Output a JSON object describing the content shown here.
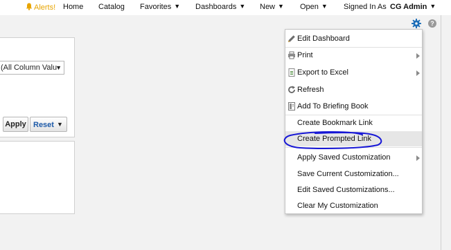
{
  "header": {
    "alerts_label": "Alerts!",
    "alerts_color": "#e8a500",
    "nav": {
      "home": "Home",
      "catalog": "Catalog",
      "favorites": "Favorites",
      "dashboards": "Dashboards",
      "new": "New",
      "open": "Open"
    },
    "signed_in_as": "Signed In As",
    "user_name": "CG Admin",
    "caret": "▼"
  },
  "prompt": {
    "select_value": "(All Column Valu",
    "apply_label": "Apply",
    "reset_label": "Reset"
  },
  "toolbar": {
    "settings_icon": "gear-icon",
    "help_icon": "help-icon",
    "help_glyph": "?",
    "accent": "#1e6fb8"
  },
  "page_options_menu": {
    "items": [
      {
        "label": "Edit Dashboard",
        "icon": "pencil-icon"
      },
      {
        "label": "Print",
        "icon": "printer-icon",
        "submenu": true
      },
      {
        "label": "Export to Excel",
        "icon": "excel-icon",
        "submenu": true
      },
      {
        "label": "Refresh",
        "icon": "refresh-icon"
      },
      {
        "label": "Add To Briefing Book",
        "icon": "briefing-book-icon"
      },
      {
        "label": "Create Bookmark Link"
      },
      {
        "label": "Create Prompted Link",
        "highlighted": true
      },
      {
        "label": "Apply Saved Customization",
        "submenu": true
      },
      {
        "label": "Save Current Customization..."
      },
      {
        "label": "Edit Saved Customizations..."
      },
      {
        "label": "Clear My Customization"
      }
    ],
    "highlight_color": "#e6e6e6",
    "annotation_color": "#1717d6"
  }
}
